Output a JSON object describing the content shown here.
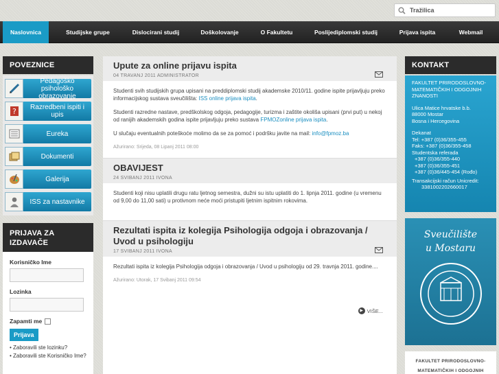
{
  "search": {
    "label": "Tražilica"
  },
  "nav": {
    "items": [
      {
        "label": "Naslovnica"
      },
      {
        "label": "Studijske grupe"
      },
      {
        "label": "Dislocirani studij"
      },
      {
        "label": "Doškolovanje"
      },
      {
        "label": "O Fakultetu"
      },
      {
        "label": "Poslijediplomski studij"
      },
      {
        "label": "Prijava ispita"
      },
      {
        "label": "Webmail"
      }
    ],
    "active_color": "#1a9bc6"
  },
  "sidebar": {
    "title": "POVEZNICE",
    "links": [
      {
        "label": "Pedagoško psihološko obrazovanje",
        "icon": "pen-icon"
      },
      {
        "label": "Razredbeni ispiti i upis",
        "icon": "question-card-icon"
      },
      {
        "label": "Eureka",
        "icon": "newspaper-icon"
      },
      {
        "label": "Dokumenti",
        "icon": "documents-icon"
      },
      {
        "label": "Galerija",
        "icon": "palette-icon"
      },
      {
        "label": "ISS za nastavnike",
        "icon": "person-icon"
      }
    ]
  },
  "login": {
    "title": "PRIJAVA ZA IZDAVAČE",
    "username_label": "Korisničko Ime",
    "password_label": "Lozinka",
    "remember_label": "Zapamti me",
    "submit_label": "Prijava",
    "forgot_password": "Zaboravili ste lozinku?",
    "forgot_username": "Zaboravili ste Korisničko Ime?"
  },
  "articles": [
    {
      "title": "Upute za online prijavu ispita",
      "meta": "04 TRAVANJ 2011  ADMINISTRATOR",
      "p1_text": "Studenti svih studijskih grupa upisani na preddiplomski studij akademske 2010/11. godine ispite prijavljuju preko informacijskog sustava sveučilišta: ",
      "p1_link": "ISS online prijava ispita",
      "p1_end": ".",
      "p2_text": "Studenti razredne nastave, predškolskog odgoja, pedagogije, turizma i zaštite okoliša upisani (prvi put) u nekoj od ranijih akademskih godina ispite prijavljuju preko sustava ",
      "p2_link": "FPMOZonline prijava ispita",
      "p2_end": ".",
      "p3_text": "U slučaju eventualnih poteškoće molimo da se za pomoć i podršku javite na mail: ",
      "p3_link": "info@fpmoz.ba",
      "updated": "Ažurirano: Srijeda, 08 Lipanj 2011 08:00"
    },
    {
      "title": "OBAVIJEST",
      "meta": "24 SVIBANJ 2011  IVONA",
      "p1_text": "Studenti koji nisu uplatili drugu ratu ljetnog semestra, dužni su istu uplatiti do 1. lipnja 2011. godine (u vremenu od 9,00 do 11,00 sati) u protivnom neće moći pristupiti ljetnim ispitnim rokovima."
    },
    {
      "title": "Rezultati ispita iz kolegija Psihologija odgoja i obrazovanja / Uvod u psihologiju",
      "meta": "17 SVIBANJ 2011  IVONA",
      "p1_text": "Rezultati ispita iz kolegija Psihologija odgoja i obrazovanja / Uvod u psihologiju od 29. travnja 2011. godine....",
      "updated": "Ažurirano: Utorak, 17 Svibanj 2011 09:54",
      "more_label": "VIŠE..."
    }
  ],
  "contact": {
    "title": "KONTAKT",
    "faculty": "FAKULTET PRIRODOSLOVNO-MATEMATIČKIH I ODGOJNIH ZNANOSTI",
    "address1": "Ulica Matice hrvatske b.b.",
    "address2": "88000 Mostar",
    "address3": "Bosna i Hercegovina",
    "dean_label": "Dekanat",
    "tel": "Tel:     +387 (0)36/355-455",
    "fax": "Faks:   +387 (0)36/355-458",
    "ref_label": "Studentska referada",
    "ref1": "+387 (0)36/355-440",
    "ref2": "+387 (0)36/355-451",
    "ref3": "+387 (0)36/445-454 (Rođo)",
    "bank_label": "Transakcijski račun Unicredit:",
    "bank_no": "3381002202660017"
  },
  "logo": {
    "line1": "Sveučilište",
    "line2": "u Mostaru"
  },
  "footer_right": {
    "line1": "FAKULTET PRIRODOSLOVNO-",
    "line2": "MATEMATIČKIH I ODGOJNIH"
  }
}
